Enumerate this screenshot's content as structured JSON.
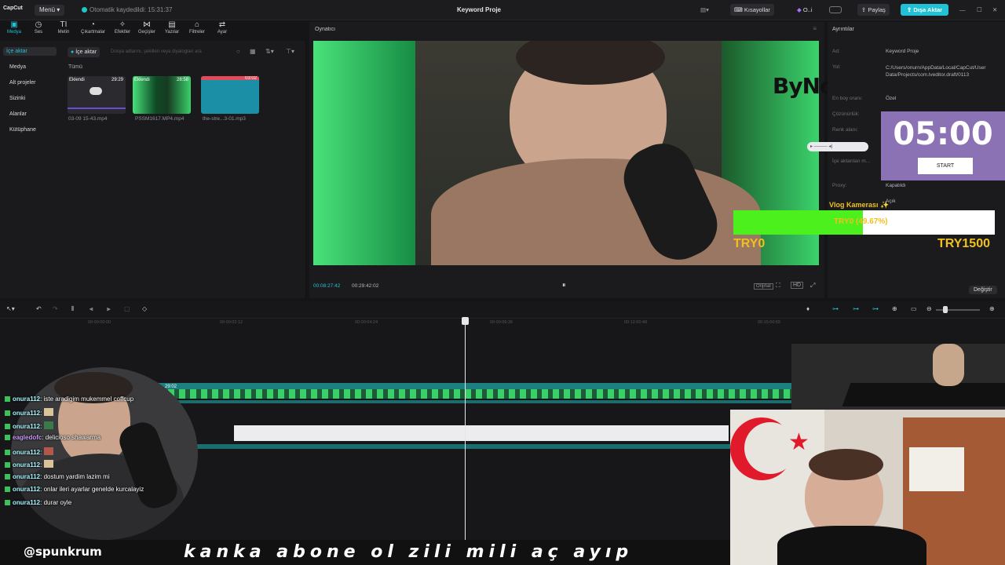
{
  "topbar": {
    "logo": "CapCut",
    "menu": "Menü ▾",
    "autosave": "Otomatik kaydedildi: 15:31:37",
    "title": "Keyword Proje",
    "shortcuts": "Kısayollar",
    "user": "O..i",
    "share": "Paylaş",
    "export": "Dışa Aktar"
  },
  "tools": [
    {
      "label": "Medya",
      "icon": "media-icon"
    },
    {
      "label": "Ses",
      "icon": "audio-icon"
    },
    {
      "label": "Metin",
      "icon": "text-icon"
    },
    {
      "label": "Çıkartmalar",
      "icon": "sticker-icon"
    },
    {
      "label": "Efektler",
      "icon": "effects-icon"
    },
    {
      "label": "Geçişler",
      "icon": "transitions-icon"
    },
    {
      "label": "Yazılar",
      "icon": "captions-icon"
    },
    {
      "label": "Filtreler",
      "icon": "filters-icon"
    },
    {
      "label": "Ayar",
      "icon": "adjust-icon"
    }
  ],
  "left": {
    "nav": [
      "İçe aktar",
      "Medya",
      "Alt projeler",
      "Sizinki",
      "Alanlar",
      "Kütüphane"
    ],
    "import_chip": "İçe aktar",
    "search_placeholder": "Dosya adlarını, şekilleri veya diyalogları ara",
    "all_label": "Tümü",
    "media": [
      {
        "badge": "Eklendi",
        "duration": "29:29",
        "name": "03-09 15-43.mp4"
      },
      {
        "badge": "Eklendi",
        "duration": "28:58",
        "name": "PSSM1617.MP4.mp4"
      },
      {
        "badge": "",
        "duration": "03:02",
        "name": "the-stre...3-01.mp3"
      }
    ]
  },
  "player": {
    "title": "Oynatıcı",
    "time_current": "00:08:27:42",
    "time_total": "00:29:42:02",
    "ratio": "Orijinal",
    "brand": "ByNoGame"
  },
  "details": {
    "title": "Ayrıntılar",
    "rows": [
      {
        "k": "Ad:",
        "v": "Keyword Proje"
      },
      {
        "k": "Yol:",
        "v": "C:/Users/onurn/AppData/Local/CapCut/User Data/Projects/com.lveditor.draft/0113"
      },
      {
        "k": "En boy oranı:",
        "v": "Özel"
      },
      {
        "k": "Çözünürlük:",
        "v": ""
      },
      {
        "k": "Renk alanı:",
        "v": ""
      },
      {
        "k": "İçe aktarılan m...",
        "v": ""
      },
      {
        "k": "Proxy:",
        "v": "Kapatıldı"
      },
      {
        "k": "Vlog Kamerası ✨",
        "v": "Açık"
      }
    ],
    "change": "Değiştir"
  },
  "overlay": {
    "timer": "05:00",
    "start": "START",
    "goal_text": "TRY0 (49.67%)",
    "goal_percent": 49.67,
    "goal_min": "TRY0",
    "goal_max": "TRY1500"
  },
  "chat": [
    {
      "user": "onura112",
      "text": ": iste aradigim mukemmel coffcup",
      "color": "#a8f7ff"
    },
    {
      "user": "onura112",
      "text": ": ",
      "color": "#a8f7ff"
    },
    {
      "user": "onura112",
      "text": ": ",
      "color": "#a8f7ff"
    },
    {
      "user": "eagledofc",
      "text": ": delicioso shawarma",
      "color": "#c99bff"
    },
    {
      "user": "onura112",
      "text": ": ",
      "color": "#a8f7ff"
    },
    {
      "user": "onura112",
      "text": ": ",
      "color": "#a8f7ff"
    },
    {
      "user": "onura112",
      "text": ": dostum yardim lazim mi",
      "color": "#a8f7ff"
    },
    {
      "user": "onura112",
      "text": ": onlar ileri ayarlar genelde kurcalayiz",
      "color": "#a8f7ff"
    },
    {
      "user": "onura112",
      "text": ": durar oyle",
      "color": "#a8f7ff"
    }
  ],
  "ticker": {
    "handle": "@spunkrum",
    "message": "kanka abone ol zili mili aç ayıp"
  },
  "timeline": {
    "ticks": [
      "00:00:00:00",
      "00:00:02:12",
      "00:00:04:24",
      "00:00:06:36",
      "00:12:00:48",
      "00:15:00:55"
    ],
    "clip_label": "29:02"
  }
}
